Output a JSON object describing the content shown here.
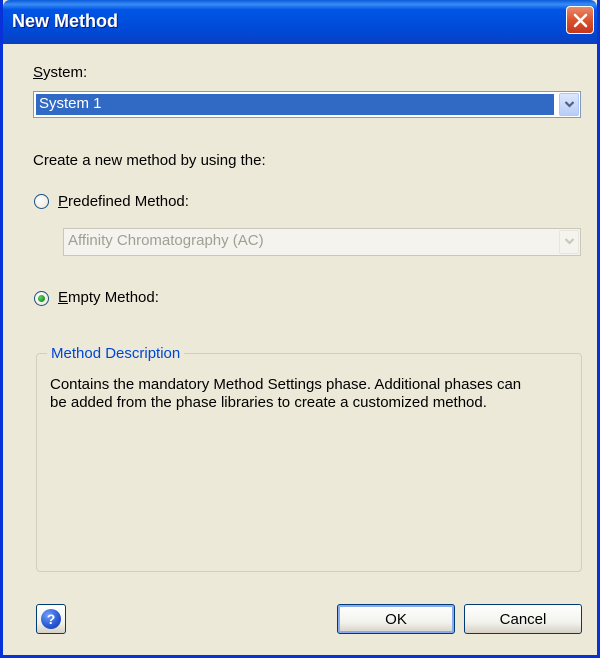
{
  "window": {
    "title": "New Method"
  },
  "system": {
    "label_first": "S",
    "label_rest": "ystem:",
    "selected": "System 1"
  },
  "create_prompt": "Create a new method by using the:",
  "predefined": {
    "label_first": "P",
    "label_rest": "redefined Method:",
    "checked": false,
    "selected": "Affinity Chromatography (AC)"
  },
  "empty": {
    "label_first": "E",
    "label_rest": "mpty Method:",
    "checked": true
  },
  "description": {
    "title": "Method Description",
    "text": "Contains the mandatory Method Settings phase. Additional phases can be added from the phase libraries to create a customized method."
  },
  "buttons": {
    "ok": "OK",
    "cancel": "Cancel",
    "help_glyph": "?"
  },
  "icons": {
    "close": "close-icon",
    "dropdown": "chevron-down-icon",
    "help": "help-icon"
  },
  "colors": {
    "title_bar": "#0055e5",
    "accent": "#316ac5",
    "group_title": "#0046d5",
    "close": "#d9532f"
  }
}
